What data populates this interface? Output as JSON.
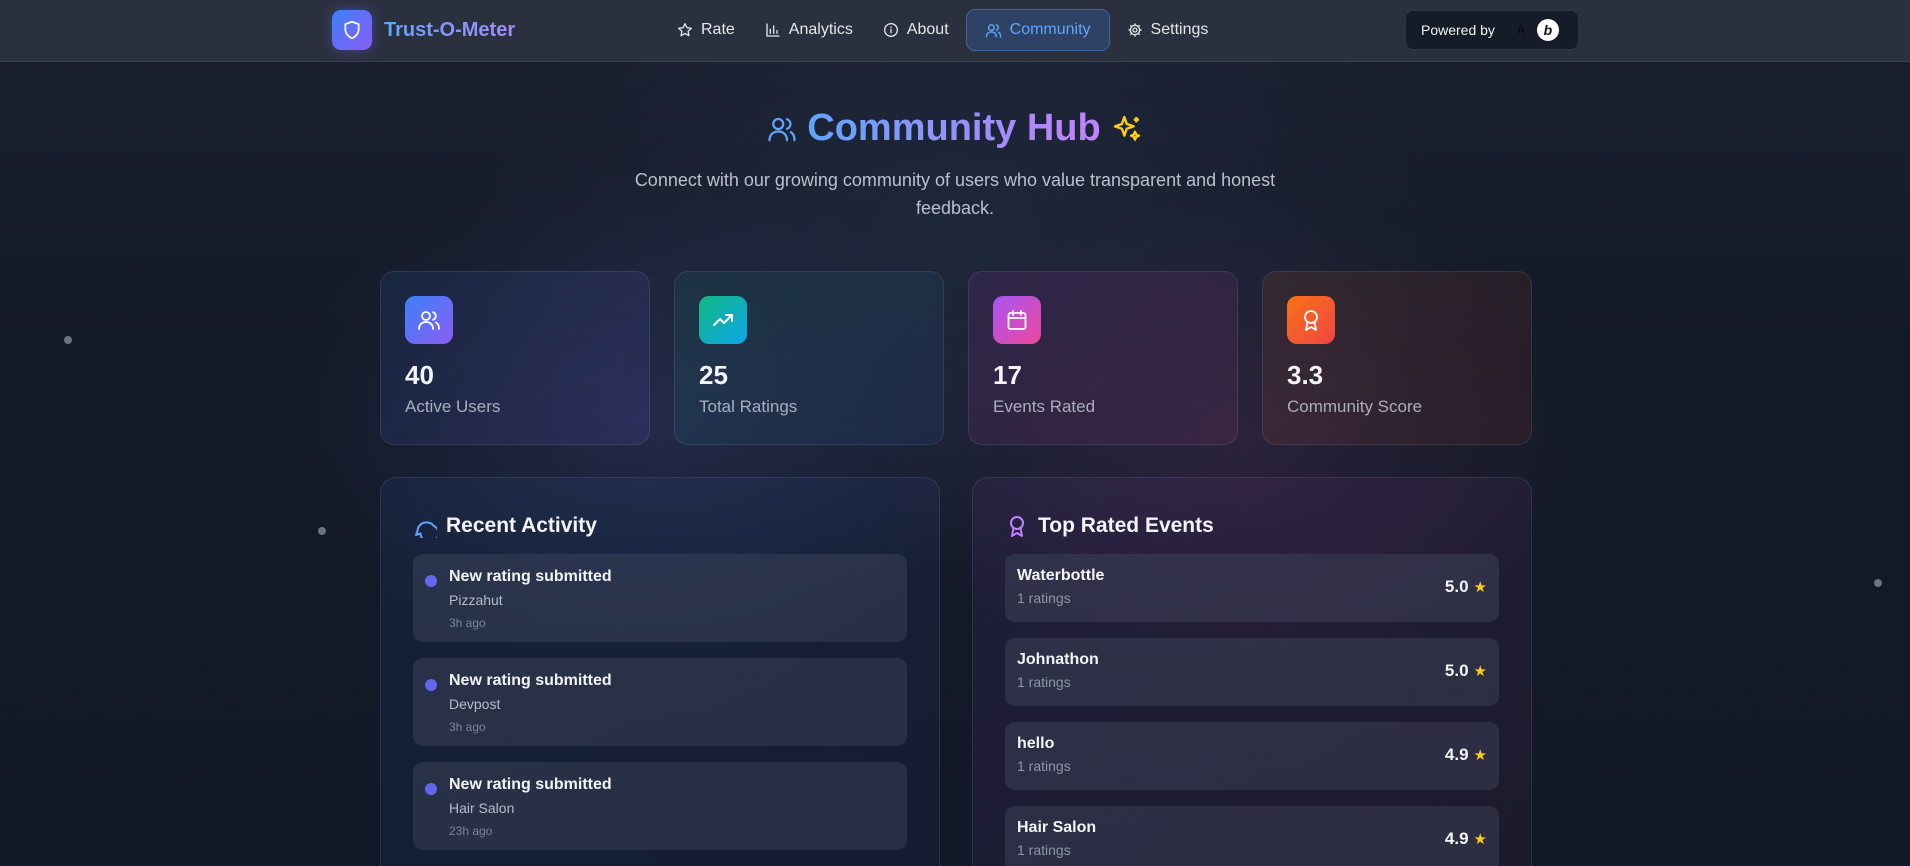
{
  "nav": {
    "brand": "Trust-O-Meter",
    "items": [
      {
        "label": "Rate",
        "icon": "star-icon",
        "active": false
      },
      {
        "label": "Analytics",
        "icon": "bar-chart-icon",
        "active": false
      },
      {
        "label": "About",
        "icon": "info-icon",
        "active": false
      },
      {
        "label": "Community",
        "icon": "users-icon",
        "active": true
      },
      {
        "label": "Settings",
        "icon": "gear-icon",
        "active": false
      }
    ],
    "powered_by": "Powered by",
    "powered_a": "A",
    "powered_b": "b"
  },
  "hero": {
    "title": "Community Hub",
    "subtitle": "Connect with our growing community of users who value transparent and honest feedback."
  },
  "stats": [
    {
      "value": "40",
      "label": "Active Users",
      "icon": "users-icon",
      "color": "#3b82f6"
    },
    {
      "value": "25",
      "label": "Total Ratings",
      "icon": "trending-up-icon",
      "color": "#10b981"
    },
    {
      "value": "17",
      "label": "Events Rated",
      "icon": "calendar-icon",
      "color": "#d946ef"
    },
    {
      "value": "3.3",
      "label": "Community Score",
      "icon": "award-icon",
      "color": "#f97316"
    }
  ],
  "recent_activity": {
    "title": "Recent Activity",
    "items": [
      {
        "title": "New rating submitted",
        "subject": "Pizzahut",
        "ago": "3h ago"
      },
      {
        "title": "New rating submitted",
        "subject": "Devpost",
        "ago": "3h ago"
      },
      {
        "title": "New rating submitted",
        "subject": "Hair Salon",
        "ago": "23h ago"
      }
    ]
  },
  "top_rated": {
    "title": "Top Rated Events",
    "items": [
      {
        "name": "Waterbottle",
        "count": "1 ratings",
        "score": "5.0"
      },
      {
        "name": "Johnathon",
        "count": "1 ratings",
        "score": "5.0"
      },
      {
        "name": "hello",
        "count": "1 ratings",
        "score": "4.9"
      },
      {
        "name": "Hair Salon",
        "count": "1 ratings",
        "score": "4.9"
      }
    ],
    "star": "★"
  }
}
